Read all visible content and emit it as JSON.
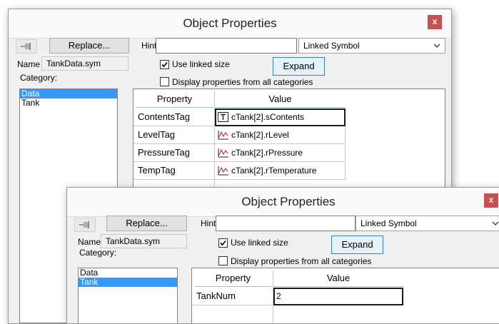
{
  "back": {
    "title": "Object Properties",
    "close": "x",
    "replace": "Replace...",
    "hint_label": "Hint:",
    "hint_value": "",
    "mode": "Linked Symbol",
    "name_label": "Name",
    "name_value": "TankData.sym",
    "use_linked_size": "Use linked size",
    "display_all": "Display properties from all categories",
    "expand": "Expand",
    "category_label": "Category:",
    "categories": [
      {
        "label": "Data",
        "selected": true
      },
      {
        "label": "Tank",
        "selected": false
      }
    ],
    "col_property": "Property",
    "col_value": "Value",
    "rows": [
      {
        "property": "ContentsTag",
        "value": "cTank[2].sContents",
        "icon": "text-tag-icon"
      },
      {
        "property": "LevelTag",
        "value": "cTank[2].rLevel",
        "icon": "analog-tag-icon"
      },
      {
        "property": "PressureTag",
        "value": "cTank[2].rPressure",
        "icon": "analog-tag-icon"
      },
      {
        "property": "TempTag",
        "value": "cTank[2].rTemperature",
        "icon": "analog-tag-icon"
      }
    ]
  },
  "front": {
    "title": "Object Properties",
    "close": "x",
    "replace": "Replace...",
    "hint_label": "Hint:",
    "hint_value": "",
    "mode": "Linked Symbol",
    "name_label": "Name",
    "name_value": "TankData.sym",
    "use_linked_size": "Use linked size",
    "display_all": "Display properties from all categories",
    "expand": "Expand",
    "category_label": "Category:",
    "categories": [
      {
        "label": "Data",
        "selected": false
      },
      {
        "label": "Tank",
        "selected": true
      }
    ],
    "col_property": "Property",
    "col_value": "Value",
    "rows": [
      {
        "property": "TankNum",
        "value": "2"
      }
    ]
  },
  "colors": {
    "close_bg": "#c75050",
    "selection": "#3399ff"
  },
  "icons": {
    "pin": "pin-icon",
    "dropdown": "chevron-down-icon",
    "check": "checkmark-icon"
  }
}
